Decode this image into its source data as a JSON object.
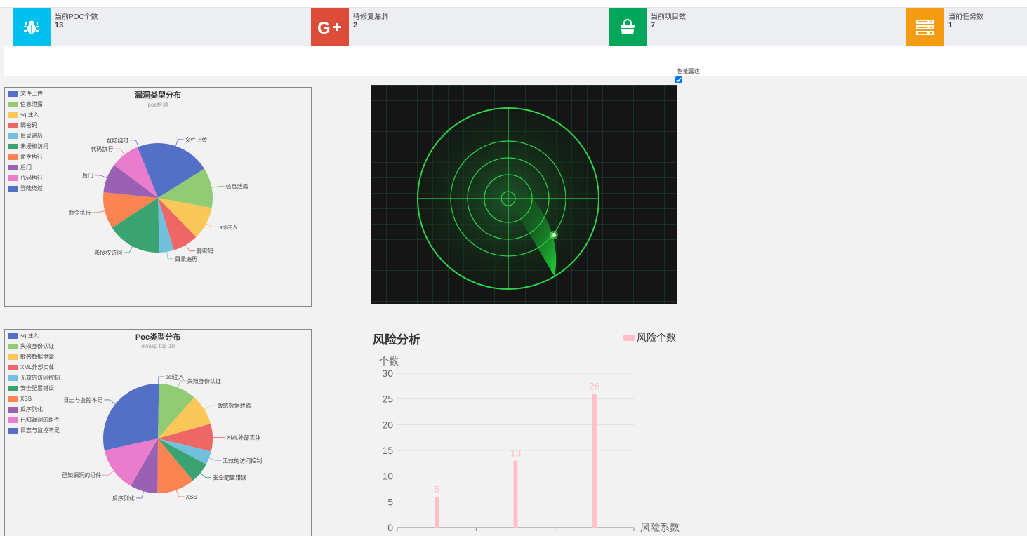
{
  "stats": [
    {
      "label": "当前POC个数",
      "value": "13",
      "color": "#00c0ef",
      "icon": "bug-icon"
    },
    {
      "label": "待修复漏洞",
      "value": "2",
      "color": "#dd4b39",
      "icon": "google-plus-icon"
    },
    {
      "label": "当前项目数",
      "value": "7",
      "color": "#00a65a",
      "icon": "shopping-bag-icon"
    },
    {
      "label": "当前任务数",
      "value": "1",
      "color": "#f39c12",
      "icon": "server-icon"
    }
  ],
  "radar": {
    "label": "智能雷达",
    "checked": true
  },
  "colors": [
    "#5470c6",
    "#91cc75",
    "#fac858",
    "#ee6666",
    "#73c0de",
    "#3ba272",
    "#fc8452",
    "#9a60b4",
    "#ea7ccc",
    "#5470c6"
  ],
  "vuln_chart": {
    "title": "漏洞类型分布",
    "subtitle": "poc检测",
    "legend": [
      "文件上传",
      "信息泄露",
      "sql注入",
      "弱密码",
      "目录遍历",
      "未授权访问",
      "命令执行",
      "后门",
      "代码执行",
      "登陆绕过"
    ]
  },
  "poc_chart": {
    "title": "Poc类型分布",
    "subtitle": "owasp top 10",
    "legend": [
      "sql注入",
      "失效身份认证",
      "敏感数据泄露",
      "XML外部实体",
      "无效的访问控制",
      "安全配置错误",
      "XSS",
      "反序列化",
      "已知漏洞的组件",
      "日志与监控不足"
    ]
  },
  "risk": {
    "title": "风险分析",
    "legend": "风险个数",
    "ylabel": "个数",
    "xlabel": "风险系数",
    "bar_color": "#ffc0cb"
  },
  "chart_data": [
    {
      "type": "pie",
      "title": "漏洞类型分布",
      "subtitle": "poc检测",
      "labels": [
        "文件上传",
        "信息泄露",
        "sql注入",
        "弱密码",
        "目录遍历",
        "未授权访问",
        "命令执行",
        "后门",
        "代码执行",
        "登陆绕过"
      ],
      "values": [
        20,
        11,
        9,
        7,
        4,
        15,
        10,
        8,
        8,
        0.5
      ]
    },
    {
      "type": "pie",
      "title": "Poc类型分布",
      "subtitle": "owasp top 10",
      "labels": [
        "sql注入",
        "失效身份认证",
        "敏感数据泄露",
        "XML外部实体",
        "无效的访问控制",
        "安全配置错误",
        "XSS",
        "反序列化",
        "已知漏洞的组件",
        "日志与监控不足"
      ],
      "values": [
        0.3,
        11,
        9,
        8,
        4,
        6,
        11,
        8,
        13,
        28
      ]
    },
    {
      "type": "bar",
      "title": "风险分析",
      "xlabel": "风险系数",
      "ylabel": "个数",
      "series": [
        {
          "name": "风险个数",
          "values": [
            6,
            13,
            26
          ]
        }
      ],
      "ylim": [
        0,
        30
      ],
      "yticks": [
        0,
        5,
        10,
        15,
        20,
        25,
        30
      ]
    }
  ]
}
